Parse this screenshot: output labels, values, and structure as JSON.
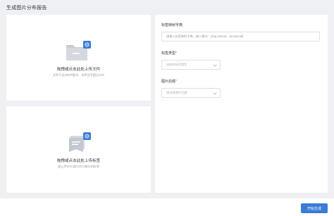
{
  "page": {
    "title": "生成图片分布报告"
  },
  "upload_file": {
    "title": "拖拽或点击此处上传文件",
    "hint": "文件只支持ZIP格式，文件名不超过10G"
  },
  "upload_label": {
    "title": "拖拽或点击此处上传标签",
    "hint": "请上传VOC或COCO格式的标签"
  },
  "form": {
    "dict_label": "标签映射字典",
    "dict_placeholder": "请输入标签映射字典，输入格式：{dog:animal，cat:animal}",
    "label_type_label": "标签类型",
    "label_type_placeholder": "请选择标签类型",
    "image_dim_label": "图片后缀",
    "image_dim_placeholder": "请选择图片后缀",
    "required_mark": "*"
  },
  "footer": {
    "start_button": "开始生成"
  },
  "colors": {
    "accent": "#3a7bd5",
    "required": "#e84a4a",
    "background": "#eef0f4"
  }
}
